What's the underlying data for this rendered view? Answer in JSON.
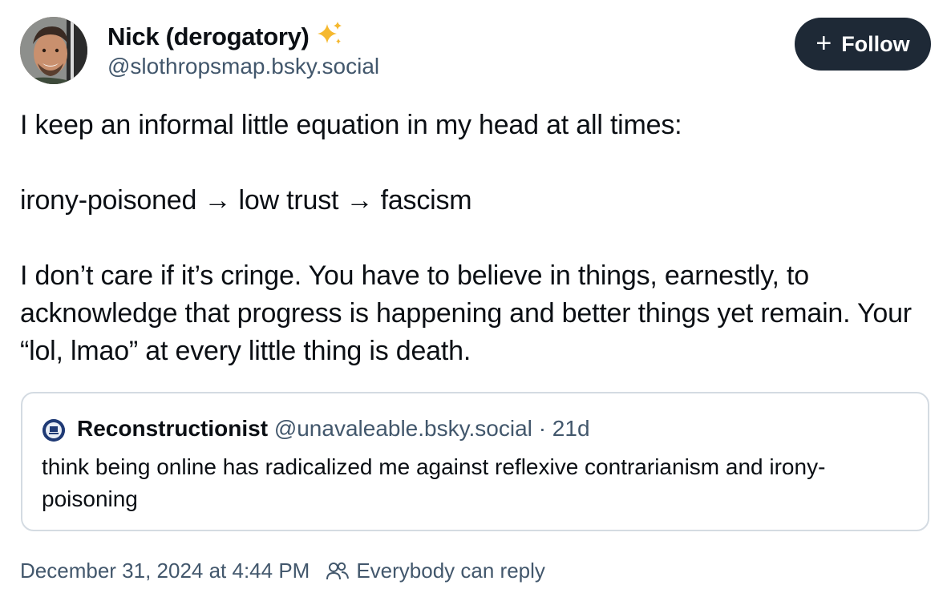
{
  "author": {
    "display_name": "Nick (derogatory)",
    "handle": "@slothropsmap.bsky.social"
  },
  "follow_button": {
    "label": "Follow"
  },
  "post": {
    "paragraphs": [
      "I keep an informal little equation in my head at all times:",
      "irony-poisoned → low trust → fascism",
      "I don’t care if it’s cringe. You have to believe in things, earnestly, to acknowledge that progress is happening and better things yet remain. Your “lol, lmao” at every little thing is death."
    ]
  },
  "quote": {
    "display_name": "Reconstructionist",
    "handle": "@unavaleable.bsky.social",
    "separator": "·",
    "age": "21d",
    "text": "think being online has radicalized me against reflexive contrarianism and irony-poisoning"
  },
  "footer": {
    "timestamp": "December 31, 2024 at 4:44 PM",
    "reply_setting": "Everybody can reply"
  },
  "colors": {
    "accent_button": "#1e2936",
    "muted_text": "#42576c",
    "border": "#d4dbe2",
    "sparkle": "#f5b82e"
  },
  "icons": [
    "sparkles-icon",
    "plus-icon",
    "people-icon"
  ]
}
